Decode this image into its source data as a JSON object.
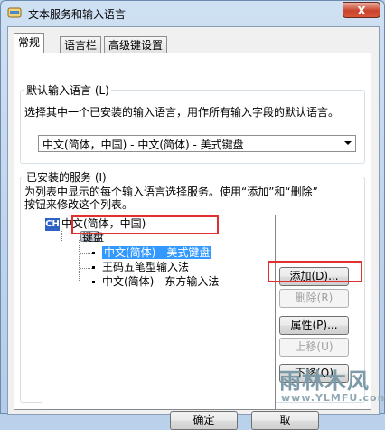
{
  "window": {
    "title": "文本服务和输入语言",
    "close_glyph": "X"
  },
  "tabs": [
    {
      "label": "常规"
    },
    {
      "label": "语言栏"
    },
    {
      "label": "高级键设置"
    }
  ],
  "default_lang": {
    "legend": "默认输入语言 (L)",
    "desc": "选择其中一个已安装的输入语言，用作所有输入字段的默认语言。",
    "selected": "中文(简体，中国) - 中文(简体) - 美式键盘"
  },
  "services": {
    "legend": "已安装的服务 (I)",
    "desc_line1": "为列表中显示的每个输入语言选择服务。使用“添加”和“删除”",
    "desc_line2": "按钮来修改这个列表。",
    "tree": {
      "lang_code": "CH",
      "lang": "中文(简体，中国)",
      "group": "键盘",
      "items": [
        "中文(简体) - 美式键盘",
        "王码五笔型输入法",
        "中文(简体) - 东方输入法"
      ]
    },
    "buttons": {
      "add": "添加(D)...",
      "remove": "删除(R)",
      "properties": "属性(P)...",
      "move_up": "上移(U)",
      "move_down": "下移(O)"
    }
  },
  "footer": {
    "ok": "确定",
    "cancel": "取"
  },
  "watermark": {
    "title": "雨林木风",
    "url": "www.YLMFU.com"
  }
}
